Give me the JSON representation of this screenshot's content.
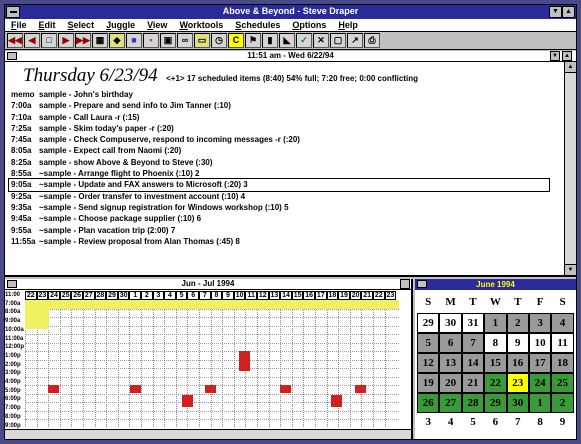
{
  "window": {
    "title": "Above & Beyond - Steve Draper"
  },
  "menu": [
    "File",
    "Edit",
    "Select",
    "Juggle",
    "View",
    "Worktools",
    "Schedules",
    "Options",
    "Help"
  ],
  "toolbar": {
    "icons": [
      "rewind-icon",
      "prev-icon",
      "day-icon",
      "next-icon",
      "fast-forward-icon",
      "calendar-icon",
      "palette-icon",
      "note-icon",
      "flag-icon",
      "print-icon",
      "link-icon",
      "folder-icon",
      "clock-icon",
      "highlight-icon",
      "pin-icon",
      "stamp-icon",
      "filter-icon",
      "check-icon",
      "delete-icon",
      "window-icon",
      "arrow-icon",
      "printer-icon"
    ]
  },
  "upper": {
    "pane_title": "11:51 am - Wed 6/22/94",
    "day": "Thursday 6/23/94",
    "stats": "<+1> 17 scheduled items (8:40) 54% full; 7:20 free; 0:00 conflicting",
    "items": [
      {
        "time": "memo",
        "text": "sample - John's birthday"
      },
      {
        "time": "7:00a",
        "text": "sample - Prepare and send info to Jim Tanner  (:10)"
      },
      {
        "time": "7:10a",
        "text": "sample - Call Laura  -r  (:15)"
      },
      {
        "time": "7:25a",
        "text": "sample - Skim today's paper  -r  (:20)"
      },
      {
        "time": "7:45a",
        "text": "sample - Check Compuserve, respond to incoming messages  -r  (:20)"
      },
      {
        "time": "8:05a",
        "text": "sample - Expect call from Naomi  (:20)"
      },
      {
        "time": "8:25a",
        "text": "sample - show Above & Beyond to Steve  (:30)"
      },
      {
        "time": "8:55a",
        "text": "~sample - Arrange flight to Phoenix  (:10)  2"
      },
      {
        "time": "9:05a",
        "text": "~sample - Update and FAX answers to Microsoft  (:20)  3",
        "selected": true
      },
      {
        "time": "9:25a",
        "text": "~sample - Order transfer to investment account  (:10)  4"
      },
      {
        "time": "9:35a",
        "text": "~sample - Send signup registration for Windows workshop  (:10)  5"
      },
      {
        "time": "9:45a",
        "text": "~sample - Choose package supplier  (:10)  6"
      },
      {
        "time": "9:55a",
        "text": "~sample - Plan vacation trip  (2:00)  7"
      },
      {
        "time": "11:55a",
        "text": "~sample - Review proposal from Alan Thomas  (:45)  8"
      }
    ]
  },
  "gantt": {
    "title": "Jun - Jul 1994",
    "days": [
      "22",
      "23",
      "24",
      "25",
      "26",
      "27",
      "28",
      "29",
      "30",
      "1",
      "2",
      "3",
      "4",
      "5",
      "6",
      "7",
      "8",
      "9",
      "10",
      "11",
      "12",
      "13",
      "14",
      "15",
      "16",
      "17",
      "18",
      "19",
      "20",
      "21",
      "22",
      "23"
    ],
    "hours": [
      "11:00",
      "7:00a",
      "8:00a",
      "9:00a",
      "10:00a",
      "11:00a",
      "12:00p",
      "1:00p",
      "2:00p",
      "3:00p",
      "4:00p",
      "5:00p",
      "6:00p",
      "7:00p",
      "8:00p",
      "9:00p"
    ]
  },
  "calendar": {
    "title": "June 1994",
    "dow": [
      "S",
      "M",
      "T",
      "W",
      "T",
      "F",
      "S"
    ],
    "weeks": [
      [
        [
          "29",
          "w"
        ],
        [
          "30",
          "w"
        ],
        [
          "31",
          "w"
        ],
        [
          "1",
          "g"
        ],
        [
          "2",
          "g"
        ],
        [
          "3",
          "g"
        ],
        [
          "4",
          "g"
        ]
      ],
      [
        [
          "5",
          "g"
        ],
        [
          "6",
          "g"
        ],
        [
          "7",
          "g"
        ],
        [
          "8",
          "w"
        ],
        [
          "9",
          "w"
        ],
        [
          "10",
          "w"
        ],
        [
          "11",
          "w"
        ]
      ],
      [
        [
          "12",
          "g"
        ],
        [
          "13",
          "g"
        ],
        [
          "14",
          "g"
        ],
        [
          "15",
          "g"
        ],
        [
          "16",
          "g"
        ],
        [
          "17",
          "g"
        ],
        [
          "18",
          "g"
        ]
      ],
      [
        [
          "19",
          "g"
        ],
        [
          "20",
          "g"
        ],
        [
          "21",
          "g"
        ],
        [
          "22",
          "n"
        ],
        [
          "23",
          "y"
        ],
        [
          "24",
          "n"
        ],
        [
          "25",
          "n"
        ]
      ],
      [
        [
          "26",
          "n"
        ],
        [
          "27",
          "n"
        ],
        [
          "28",
          "n"
        ],
        [
          "29",
          "n"
        ],
        [
          "30",
          "n"
        ],
        [
          "1",
          "n"
        ],
        [
          "2",
          "n"
        ]
      ],
      [
        [
          "3",
          "o"
        ],
        [
          "4",
          "o"
        ],
        [
          "5",
          "o"
        ],
        [
          "6",
          "o"
        ],
        [
          "7",
          "o"
        ],
        [
          "8",
          "o"
        ],
        [
          "9",
          "o"
        ]
      ]
    ]
  }
}
